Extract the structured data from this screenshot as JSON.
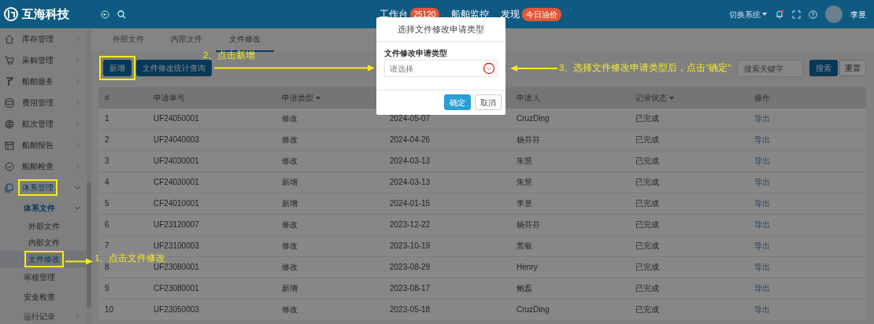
{
  "header": {
    "logo": "互海科技",
    "nav": [
      {
        "label": "工作台",
        "badge": "25120"
      },
      {
        "label": "船舶监控"
      },
      {
        "label": "发现",
        "badge": "今日油价"
      }
    ],
    "system_switch": "切换系统",
    "notification_dot": true,
    "user": "李昱"
  },
  "sidebar": {
    "items": [
      {
        "label": "库存管理",
        "expanded": false
      },
      {
        "label": "采购管理",
        "expanded": false
      },
      {
        "label": "船舶服务",
        "expanded": false
      },
      {
        "label": "费用管理",
        "expanded": false
      },
      {
        "label": "航次管理",
        "expanded": false
      },
      {
        "label": "船舶报告",
        "expanded": false
      },
      {
        "label": "船舶检查",
        "expanded": false
      },
      {
        "label": "体系管理",
        "expanded": true,
        "children": [
          {
            "label": "体系文件",
            "expanded": true,
            "children": [
              {
                "label": "外部文件",
                "selected": false
              },
              {
                "label": "内部文件",
                "selected": false
              },
              {
                "label": "文件修改",
                "selected": true
              }
            ]
          },
          {
            "label": "审核管理"
          },
          {
            "label": "安全检查"
          },
          {
            "label": "运行记录",
            "expanded": false
          }
        ]
      }
    ]
  },
  "tabs": [
    {
      "label": "外部文件",
      "selected": false
    },
    {
      "label": "内部文件",
      "selected": false
    },
    {
      "label": "文件修改",
      "selected": true
    }
  ],
  "toolbar": {
    "buttons": [
      "新增",
      "文件修改统计查询"
    ],
    "search_placeholder": "搜索关键字",
    "search_button": "搜索",
    "reset_button": "重置"
  },
  "table": {
    "columns": [
      {
        "label": "#"
      },
      {
        "label": "申请单号"
      },
      {
        "label": "申请类型",
        "sortable": true
      },
      {},
      {
        "label": "申请人"
      },
      {
        "label": "记录状态",
        "sortable": true
      },
      {
        "label": "操作"
      }
    ],
    "rows": [
      [
        "1",
        "UF24050001",
        "修改",
        "2024-05-07",
        "CruzDing",
        "已完成",
        "导出"
      ],
      [
        "2",
        "UF24040003",
        "修改",
        "2024-04-26",
        "杨芬芬",
        "已完成",
        "导出"
      ],
      [
        "3",
        "UF24030001",
        "修改",
        "2024-03-13",
        "朱慧",
        "已完成",
        "导出"
      ],
      [
        "4",
        "CF24030001",
        "新增",
        "2024-03-13",
        "朱慧",
        "已完成",
        "导出"
      ],
      [
        "5",
        "CF24010001",
        "新增",
        "2024-01-15",
        "李昱",
        "已完成",
        "导出"
      ],
      [
        "6",
        "UF23120007",
        "修改",
        "2023-12-22",
        "杨芬芬",
        "已完成",
        "导出"
      ],
      [
        "7",
        "UF23100003",
        "修改",
        "2023-10-19",
        "蒿银",
        "已完成",
        "导出"
      ],
      [
        "8",
        "UF23080001",
        "修改",
        "2023-08-29",
        "Henry",
        "已完成",
        "导出"
      ],
      [
        "9",
        "CF23080001",
        "新增",
        "2023-08-17",
        "鲍磊",
        "已完成",
        "导出"
      ],
      [
        "10",
        "UF23050003",
        "修改",
        "2023-05-18",
        "CruzDing",
        "已完成",
        "导出"
      ]
    ]
  },
  "modal": {
    "title": "选择文件修改申请类型",
    "field_label": "文件修改申请类型",
    "placeholder": "请选择",
    "confirm": "确定",
    "cancel": "取消"
  },
  "annotations": [
    "1、点击文件修改",
    "2、点击新增",
    "3、选择文件修改申请类型后，点击“确定”"
  ]
}
